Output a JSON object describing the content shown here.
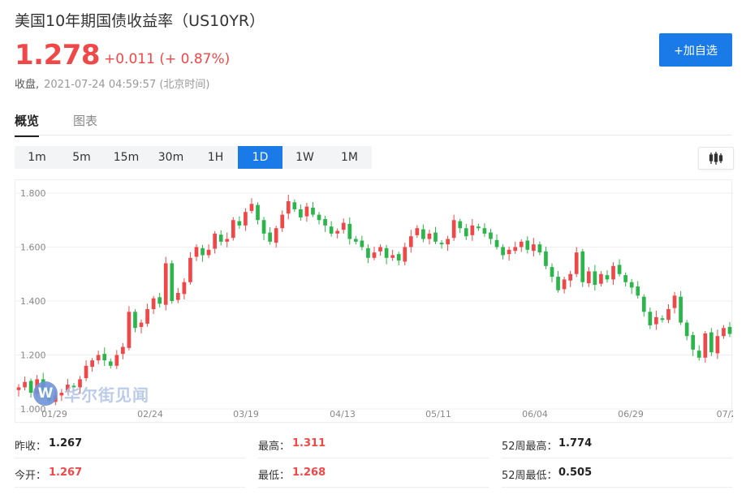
{
  "header": {
    "title": "美国10年期国债收益率（US10YR）",
    "price": "1.278",
    "change": "+0.011 (+ 0.87%)",
    "status_label": "收盘,",
    "timestamp": "2021-07-24 04:59:57 (北京时间)",
    "add_button": "+加自选"
  },
  "tabs": [
    {
      "label": "概览",
      "active": true
    },
    {
      "label": "图表",
      "active": false
    }
  ],
  "periods": [
    "1m",
    "5m",
    "15m",
    "30m",
    "1H",
    "1D",
    "1W",
    "1M"
  ],
  "active_period": "1D",
  "watermark": {
    "logo": "W",
    "text": "华尔街见闻"
  },
  "colors": {
    "up": "#f04848",
    "down": "#2bb54a",
    "accent": "#1a7be8"
  },
  "stats": [
    {
      "label": "昨收：",
      "value": "1.267",
      "color": "#222"
    },
    {
      "label": "最高：",
      "value": "1.311",
      "color": "#f04848"
    },
    {
      "label": "52周最高：",
      "value": "1.774",
      "color": "#222"
    },
    {
      "label": "今开：",
      "value": "1.267",
      "color": "#f04848"
    },
    {
      "label": "最低：",
      "value": "1.268",
      "color": "#f04848"
    },
    {
      "label": "52周最低：",
      "value": "0.505",
      "color": "#222"
    }
  ],
  "chart_data": {
    "type": "candlestick",
    "y_ticks": [
      "1.800",
      "1.600",
      "1.400",
      "1.200",
      "1.000"
    ],
    "x_ticks": [
      "01/29",
      "02/24",
      "03/19",
      "04/13",
      "05/11",
      "06/04",
      "06/29",
      "07/2"
    ],
    "ylim": [
      1.0,
      1.8
    ],
    "grid": "horizontal",
    "closes": [
      1.08,
      1.1,
      1.06,
      1.11,
      1.07,
      1.03,
      1.05,
      1.06,
      1.09,
      1.08,
      1.11,
      1.16,
      1.18,
      1.2,
      1.18,
      1.16,
      1.2,
      1.23,
      1.36,
      1.3,
      1.32,
      1.37,
      1.41,
      1.39,
      1.54,
      1.4,
      1.43,
      1.47,
      1.56,
      1.6,
      1.57,
      1.59,
      1.65,
      1.62,
      1.63,
      1.7,
      1.68,
      1.73,
      1.76,
      1.7,
      1.65,
      1.62,
      1.67,
      1.72,
      1.77,
      1.74,
      1.71,
      1.75,
      1.72,
      1.7,
      1.68,
      1.65,
      1.66,
      1.69,
      1.63,
      1.62,
      1.6,
      1.56,
      1.58,
      1.6,
      1.56,
      1.57,
      1.55,
      1.6,
      1.64,
      1.67,
      1.63,
      1.65,
      1.62,
      1.61,
      1.63,
      1.7,
      1.67,
      1.64,
      1.68,
      1.67,
      1.65,
      1.63,
      1.6,
      1.57,
      1.59,
      1.6,
      1.62,
      1.59,
      1.61,
      1.58,
      1.53,
      1.49,
      1.44,
      1.48,
      1.5,
      1.58,
      1.47,
      1.51,
      1.46,
      1.5,
      1.48,
      1.53,
      1.5,
      1.47,
      1.45,
      1.42,
      1.36,
      1.31,
      1.34,
      1.33,
      1.37,
      1.42,
      1.32,
      1.27,
      1.22,
      1.19,
      1.28,
      1.21,
      1.27,
      1.3,
      1.278
    ]
  }
}
